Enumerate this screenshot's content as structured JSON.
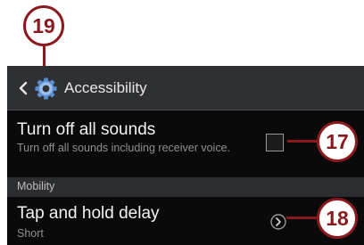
{
  "callouts": {
    "top": "19",
    "checkbox": "17",
    "arrow": "18"
  },
  "action_bar": {
    "title": "Accessibility",
    "back_icon": "back-arrow-icon",
    "app_icon": "gear-icon"
  },
  "settings": {
    "turn_off_sounds": {
      "title": "Turn off all sounds",
      "subtitle": "Turn off all sounds including receiver voice.",
      "checked": false
    },
    "section_header": "Mobility",
    "tap_and_hold": {
      "title": "Tap and hold delay",
      "value": "Short"
    }
  },
  "colors": {
    "callout": "#8b1a1f",
    "screen_bg": "#050505",
    "action_bar": "#2f3033",
    "section_bg": "#2c2d30",
    "gear_blue": "#5d8fd0"
  }
}
